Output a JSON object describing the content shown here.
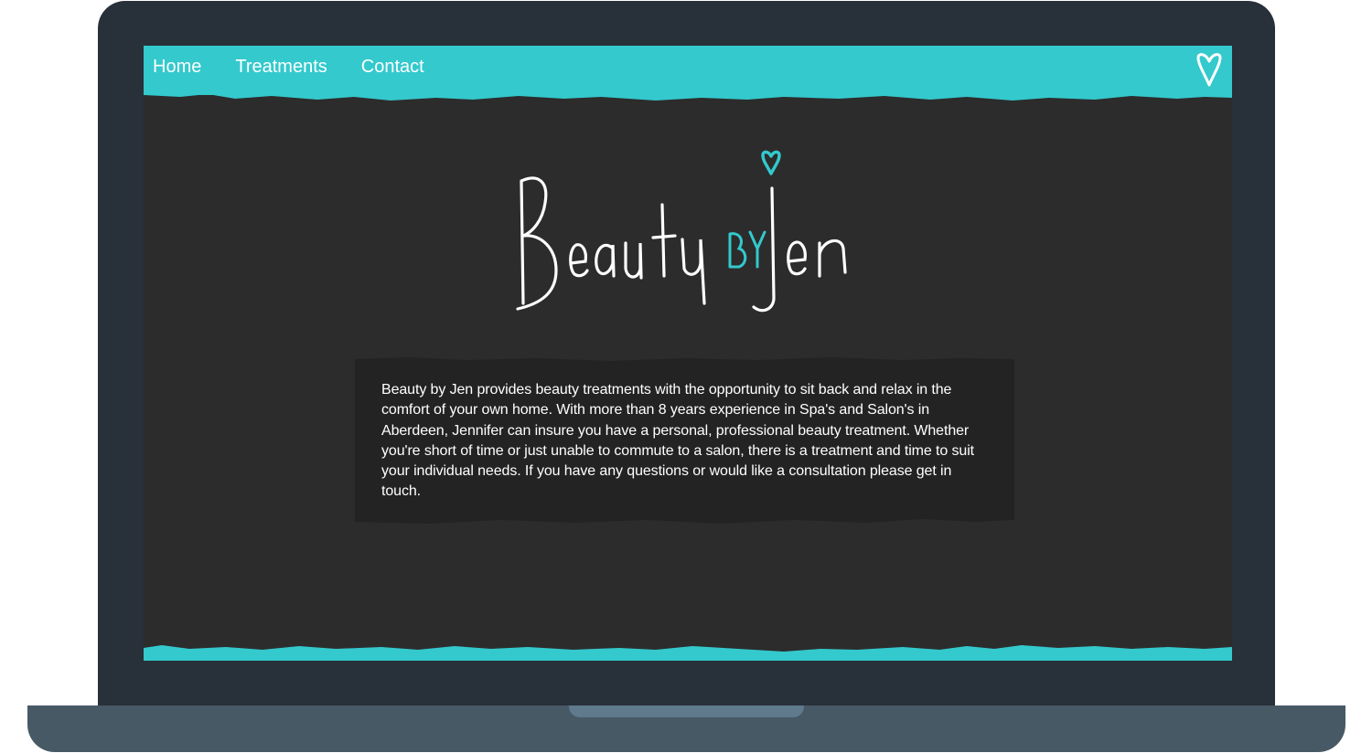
{
  "nav": {
    "links": [
      {
        "label": "Home"
      },
      {
        "label": "Treatments"
      },
      {
        "label": "Contact"
      }
    ],
    "heart_icon": "heart-outline-icon"
  },
  "logo": {
    "text_beauty": "Beauty",
    "text_by": "BY",
    "text_jen": "Jen",
    "heart_icon": "heart-outline-icon"
  },
  "about": {
    "text": "Beauty by Jen provides beauty treatments with the opportunity to sit back and relax in the comfort of your own home. With more than 8 years experience in Spa's and Salon's in Aberdeen, Jennifer can insure you have a personal, professional beauty treatment. Whether you're short of time or just unable to commute to a salon, there is a treatment and time to suit your individual needs. If you have any questions or would like a consultation please get in touch."
  },
  "colors": {
    "accent": "#33c9cd",
    "page_bg": "#2c2c2c",
    "box_bg": "#232323",
    "laptop_frame": "#283039",
    "laptop_base": "#475965"
  }
}
